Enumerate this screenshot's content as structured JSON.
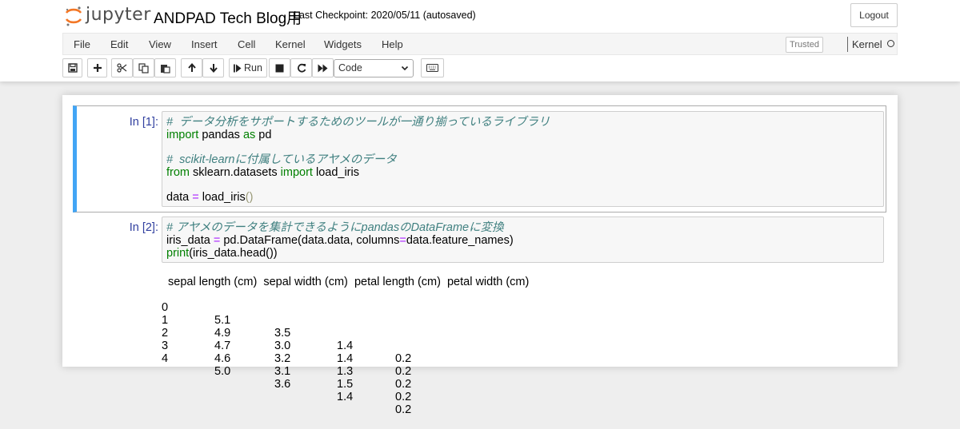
{
  "header": {
    "logo_text": "jupyter",
    "notebook_title": "ANDPAD Tech Blog用",
    "checkpoint": "Last Checkpoint: 2020/05/11   (autosaved)",
    "logout_label": "Logout"
  },
  "menubar": {
    "items": [
      "File",
      "Edit",
      "View",
      "Insert",
      "Cell",
      "Kernel",
      "Widgets",
      "Help"
    ],
    "trusted_label": "Trusted",
    "kernel_label": "Kernel"
  },
  "toolbar": {
    "buttons": [
      "save-icon",
      "plus-icon",
      "cut-icon",
      "copy-icon",
      "paste-icon",
      "arrow-up-icon",
      "arrow-down-icon",
      "run-icon",
      "stop-icon",
      "restart-icon",
      "fast-forward-icon",
      "keyboard-icon"
    ],
    "run_label": "Run",
    "cell_type": "Code"
  },
  "cells": [
    {
      "prompt": "In [1]:",
      "code": {
        "comment1": "#  データ分析をサポートするためのツールが一通り揃っているライブラリ",
        "line2_import": "import",
        "line2_mod": " pandas ",
        "line2_as": "as",
        "line2_alias": " pd",
        "comment2": "#  scikit-learnに付属しているアヤメのデータ",
        "line5_from": "from",
        "line5_mod": " sklearn.datasets ",
        "line5_import": "import",
        "line5_name": " load_iris",
        "line7_var": "data ",
        "line7_eq": "=",
        "line7_call": " load_iris",
        "line7_parens": "()"
      }
    },
    {
      "prompt": "In [2]:",
      "code": {
        "comment1": "# アヤメのデータを集計できるようにpandasのDataFrameに変換",
        "line2_var": "iris_data ",
        "line2_eq": "=",
        "line2_a": " pd.DataFrame(data.data, columns",
        "line2_eq2": "=",
        "line2_b": "data.feature_names)",
        "line3_print": "print",
        "line3_rest": "(iris_data.head())"
      },
      "output": {
        "header": "  sepal length (cm)  sepal width (cm)  petal length (cm)  petal width (cm)",
        "rows": [
          [
            "0",
            "5.1",
            "3.5",
            "1.4",
            "0.2"
          ],
          [
            "1",
            "4.9",
            "3.0",
            "1.4",
            "0.2"
          ],
          [
            "2",
            "4.7",
            "3.2",
            "1.3",
            "0.2"
          ],
          [
            "3",
            "4.6",
            "3.1",
            "1.5",
            "0.2"
          ],
          [
            "4",
            "5.0",
            "3.6",
            "1.4",
            "0.2"
          ]
        ]
      }
    }
  ],
  "colors": {
    "selected_cell_border": "#42a5f5",
    "prompt": "#303f9f",
    "comment": "#408080",
    "keyword": "#008000",
    "operator": "#aa22ff"
  }
}
